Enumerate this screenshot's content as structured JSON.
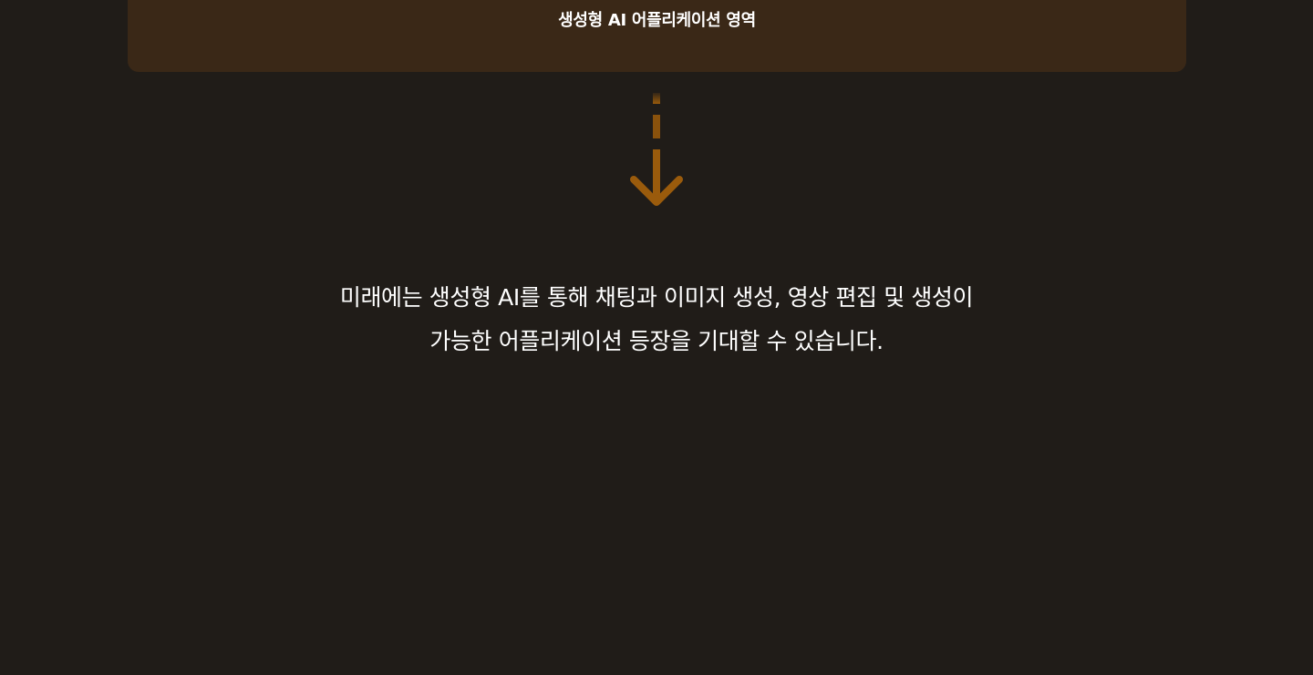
{
  "card": {
    "title": "생성형 AI 어플리케이션 영역"
  },
  "arrow": {
    "icon": "arrow-down-icon",
    "color": "#9a5b0c"
  },
  "description": {
    "line1": "미래에는 생성형 AI를 통해 채팅과 이미지 생성, 영상 편집 및 생성이",
    "line2": "가능한 어플리케이션 등장을 기대할 수 있습니다."
  },
  "colors": {
    "background": "#201c18",
    "card": "#3a2817",
    "text": "#ffffff",
    "accent": "#9a5b0c"
  }
}
